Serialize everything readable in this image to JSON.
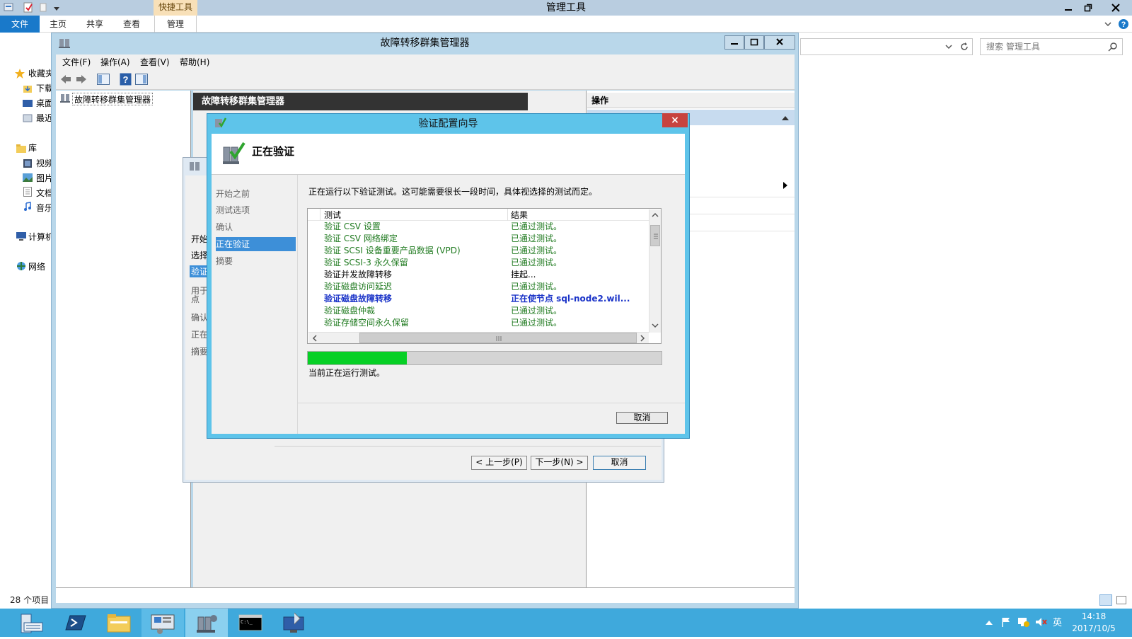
{
  "explorer": {
    "title": "管理工具",
    "quick_tools_tab": "快捷工具",
    "ribbon_tabs": [
      "文件",
      "主页",
      "共享",
      "查看",
      "管理"
    ],
    "search_placeholder": "搜索 管理工具",
    "nav": {
      "favorites": "收藏夹",
      "downloads": "下载",
      "desktop": "桌面",
      "recent": "最近",
      "libraries": "库",
      "videos": "视频",
      "pictures": "图片",
      "documents": "文档",
      "music": "音乐",
      "computer": "计算机",
      "network": "网络"
    },
    "item_count": "28 个项目"
  },
  "mmc": {
    "title": "故障转移群集管理器",
    "menu": [
      "文件(F)",
      "操作(A)",
      "查看(V)",
      "帮助(H)"
    ],
    "tree_root": "故障转移群集管理器",
    "center_header": "故障转移群集管理器",
    "actions_header": "操作"
  },
  "behind_wizard": {
    "steps": [
      "开始",
      "选择",
      "验证",
      "用于",
      "点",
      "确认",
      "正在",
      "摘要"
    ],
    "buttons": {
      "prev": "< 上一步(P)",
      "next": "下一步(N) >",
      "cancel": "取消"
    }
  },
  "dialog": {
    "title": "验证配置向导",
    "close": "×",
    "heading": "正在验证",
    "steps": [
      "开始之前",
      "测试选项",
      "确认",
      "正在验证",
      "摘要"
    ],
    "active_step": 3,
    "description": "正在运行以下验证测试。这可能需要很长一段时间，具体视选择的测试而定。",
    "table": {
      "headers": [
        "测试",
        "结果"
      ],
      "rows": [
        {
          "test": "验证 CSV 设置",
          "result": "已通过测试。",
          "state": "pass"
        },
        {
          "test": "验证 CSV 网络绑定",
          "result": "已通过测试。",
          "state": "pass"
        },
        {
          "test": "验证 SCSI 设备重要产品数据 (VPD)",
          "result": "已通过测试。",
          "state": "pass"
        },
        {
          "test": "验证 SCSI-3 永久保留",
          "result": "已通过测试。",
          "state": "pass"
        },
        {
          "test": "验证并发故障转移",
          "result": "挂起...",
          "state": "plain"
        },
        {
          "test": "验证磁盘访问延迟",
          "result": "已通过测试。",
          "state": "pass"
        },
        {
          "test": "验证磁盘故障转移",
          "result": "正在使节点 sql-node2.wil...",
          "state": "run"
        },
        {
          "test": "验证磁盘仲裁",
          "result": "已通过测试。",
          "state": "pass"
        },
        {
          "test": "验证存储空间永久保留",
          "result": "已通过测试。",
          "state": "pass"
        }
      ]
    },
    "progress": 0.28,
    "progress_text": "当前正在运行测试。",
    "cancel": "取消"
  },
  "taskbar": {
    "time": "14:18",
    "date": "2017/10/5",
    "ime": "英"
  }
}
